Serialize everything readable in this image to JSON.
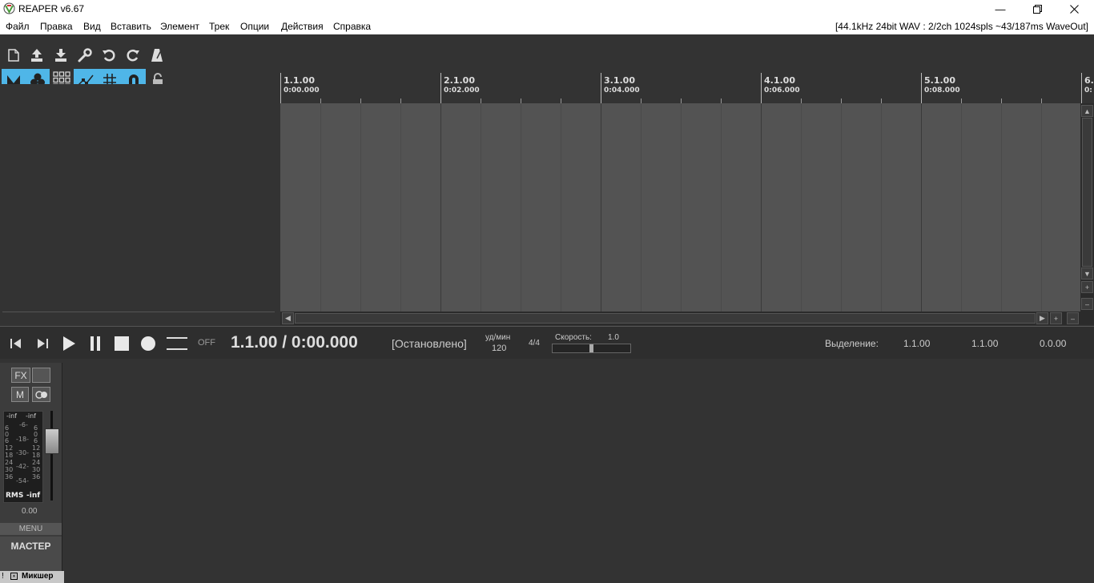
{
  "window": {
    "title": "REAPER v6.67",
    "minimize_icon": "minimize-icon",
    "maximize_icon": "restore-icon",
    "close_icon": "close-icon"
  },
  "menu": {
    "items": [
      "Файл",
      "Правка",
      "Вид",
      "Вставить",
      "Элемент",
      "Трек",
      "Опции",
      "Действия",
      "Справка"
    ],
    "status": "[44.1kHz 24bit WAV : 2/2ch 1024spls ~43/187ms WaveOut]"
  },
  "toolbar": {
    "row1": [
      "new-project-icon",
      "save-upload-icon",
      "download-icon",
      "wrench-icon",
      "undo-icon",
      "redo-icon",
      "metronome-icon"
    ],
    "row2": [
      "ripple-edit-icon",
      "grouping-icon",
      "grid-squares-icon",
      "envelope-icon",
      "grid-icon",
      "snap-magnet-icon",
      "lock-icon"
    ]
  },
  "ruler": {
    "markers": [
      {
        "beat": "1.1.00",
        "time": "0:00.000"
      },
      {
        "beat": "2.1.00",
        "time": "0:02.000"
      },
      {
        "beat": "3.1.00",
        "time": "0:04.000"
      },
      {
        "beat": "4.1.00",
        "time": "0:06.000"
      },
      {
        "beat": "5.1.00",
        "time": "0:08.000"
      },
      {
        "beat": "6.",
        "time": "0:"
      }
    ]
  },
  "transport": {
    "repeat_state": "OFF",
    "position": "1.1.00 / 0:00.000",
    "state": "[Остановлено]",
    "bpm_label": "уд/мин",
    "bpm_value": "120",
    "time_sig": "4/4",
    "rate_label": "Скорость:",
    "rate_value": "1.0",
    "selection_label": "Выделение:",
    "sel_start": "1.1.00",
    "sel_end": "1.1.00",
    "sel_len": "0.0.00"
  },
  "master": {
    "fx_label": "FX",
    "mute_label": "M",
    "peak_left": "-inf",
    "peak_right": "-inf",
    "rms_label": "RMS",
    "rms_value": "-inf",
    "volume": "0.00",
    "menu_label": "MENU",
    "name": "МАСТЕР",
    "scale_center": [
      "-6-",
      "-18-",
      "-30-",
      "-42-",
      "-54-"
    ],
    "scale_side": [
      "6",
      "0",
      "6",
      "12",
      "18",
      "24",
      "30",
      "36"
    ]
  },
  "mixer_tab": {
    "label": "Микшер"
  }
}
